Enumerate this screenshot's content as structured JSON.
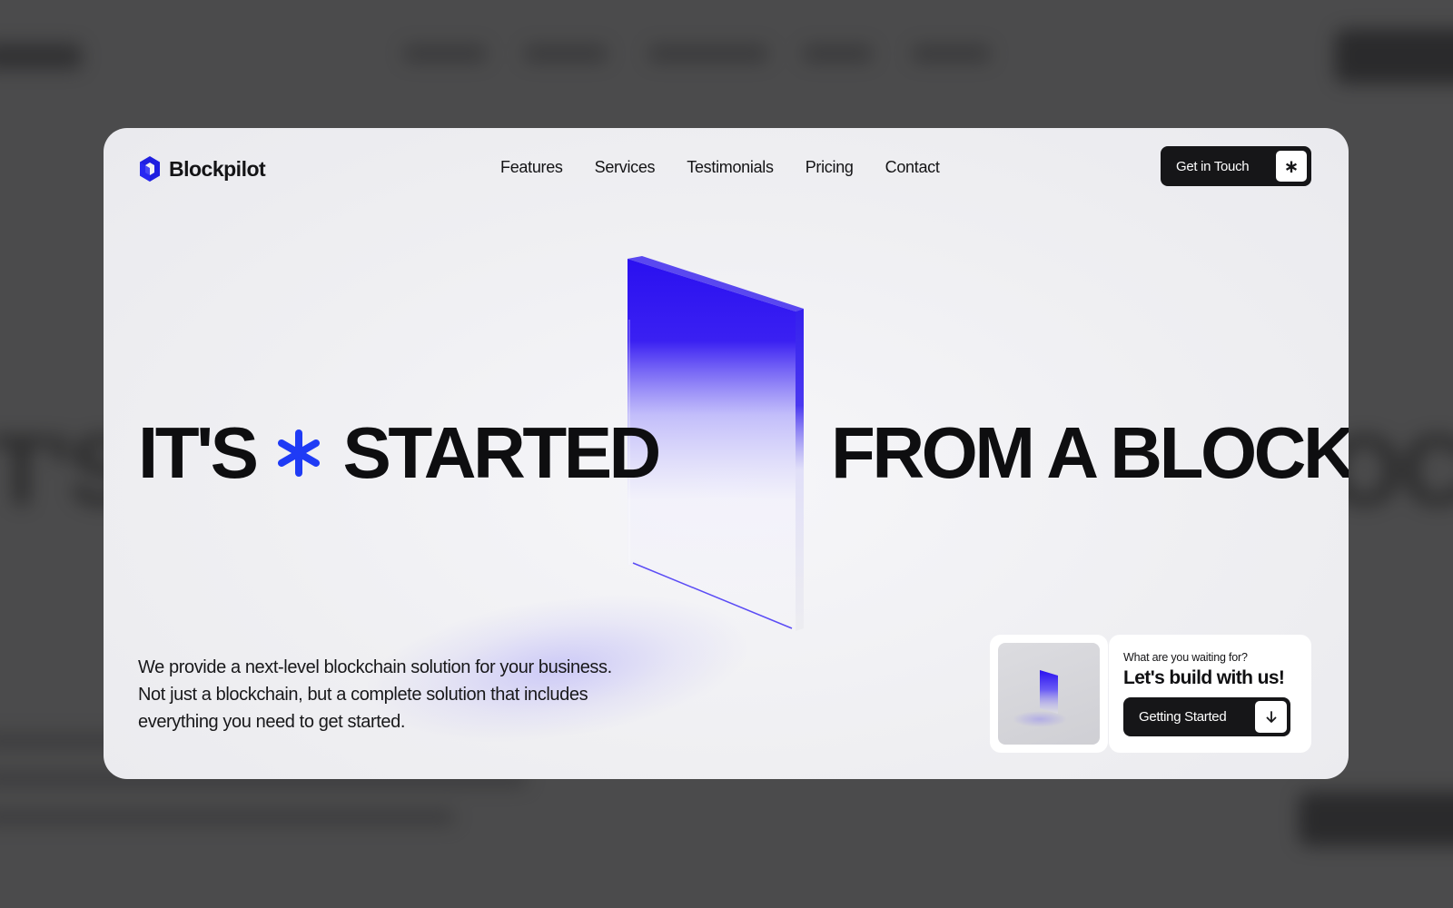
{
  "brand": {
    "name": "Blockpilot",
    "logo_icon": "hexagon-logo-icon",
    "accent": "#1f3bf5",
    "block_blue": "#2a10f0"
  },
  "nav": {
    "items": [
      "Features",
      "Services",
      "Testimonials",
      "Pricing",
      "Contact"
    ]
  },
  "header_cta": {
    "label": "Get in Touch",
    "icon": "asterisk-icon"
  },
  "hero": {
    "left_word_1": "IT'S",
    "left_word_2": "STARTED",
    "right_text": "FROM A BLOCK",
    "separator_icon": "asterisk-icon"
  },
  "description": "We provide a next-level blockchain solution for your business. Not just a blockchain, but a complete solution that includes everything you need to get started.",
  "promo": {
    "kicker": "What are you waiting for?",
    "title": "Let's build with us!",
    "button_label": "Getting Started",
    "button_icon": "arrow-down-icon"
  }
}
